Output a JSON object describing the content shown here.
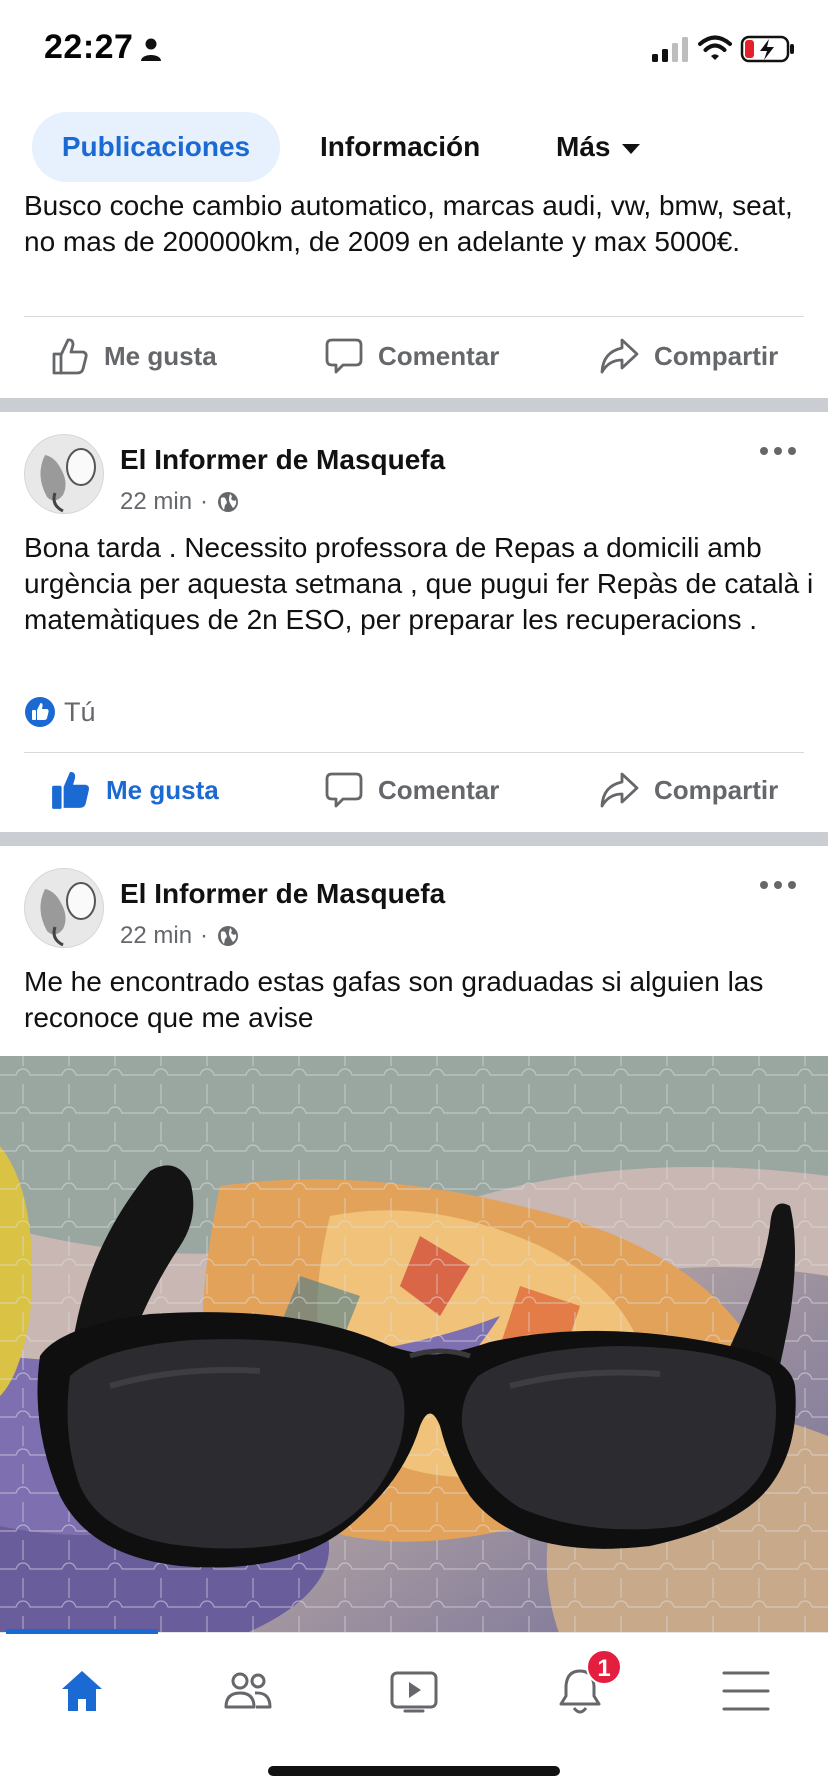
{
  "status_bar": {
    "time": "22:27",
    "icons": [
      "person-icon",
      "signal-icon",
      "wifi-icon",
      "battery-charging-icon"
    ]
  },
  "tabs": {
    "active": "Publicaciones",
    "info": "Información",
    "more": "Más"
  },
  "partial_post": {
    "text": "Busco coche cambio automatico, marcas audi, vw, bmw, seat, no mas de 200000km, de 2009 en adelante y max 5000€."
  },
  "actions": {
    "like": "Me gusta",
    "comment": "Comentar",
    "share": "Compartir"
  },
  "posts": [
    {
      "author": "El Informer de Masquefa",
      "time": "22 min",
      "audience_icon": "globe-icon",
      "text": "Bona tarda . Necessito professora de Repas a domicili amb urgència per aquesta setmana , que pugui fer Repàs de català i matemàtiques de 2n ESO, per preparar les recuperacions .",
      "reactions_label": "Tú",
      "liked": true
    },
    {
      "author": "El Informer de Masquefa",
      "time": "22 min",
      "audience_icon": "globe-icon",
      "text": "Me he encontrado estas gafas son graduadas si alguien las reconoce que me avise",
      "image": "photo of black glasses on a jigsaw puzzle"
    }
  ],
  "bottom_nav": {
    "items": [
      "home-icon",
      "friends-icon",
      "video-icon",
      "notifications-icon",
      "menu-icon"
    ],
    "notification_count": "1"
  },
  "colors": {
    "accent": "#1b69d2",
    "tab_active_bg": "#e7f0fd",
    "secondary_text": "#65676b",
    "separator": "#cacdd2",
    "badge": "#e41e3f"
  }
}
